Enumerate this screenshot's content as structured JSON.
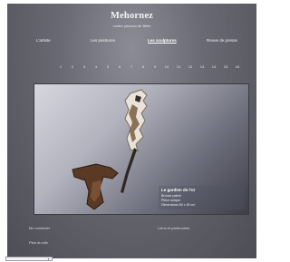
{
  "header": {
    "title": "Mehornez",
    "subtitle": "contre pinceau de Bélie"
  },
  "nav": {
    "items": [
      {
        "label": "L'artiste",
        "active": false
      },
      {
        "label": "Les peintures",
        "active": false
      },
      {
        "label": "Les sculptures",
        "active": true
      },
      {
        "label": "Revue de presse",
        "active": false
      }
    ]
  },
  "pager": {
    "numbers": [
      "1",
      "2",
      "3",
      "4",
      "5",
      "6",
      "7",
      "8",
      "9",
      "10",
      "11",
      "12",
      "13",
      "14",
      "15",
      "16"
    ]
  },
  "gallery": {
    "caption_title": "Le gardien de l'or",
    "caption_lines": [
      "Bronze patiné",
      "Pièce unique",
      "Dimensions 60 x 40 cm"
    ]
  },
  "footer": {
    "left_top": "Me contacter",
    "right_top": "Liens et partenaires",
    "left_bottom": "Plan du site"
  },
  "colors": {
    "page_bg": "#5a5a64",
    "accent_text": "#f4f4f4"
  }
}
